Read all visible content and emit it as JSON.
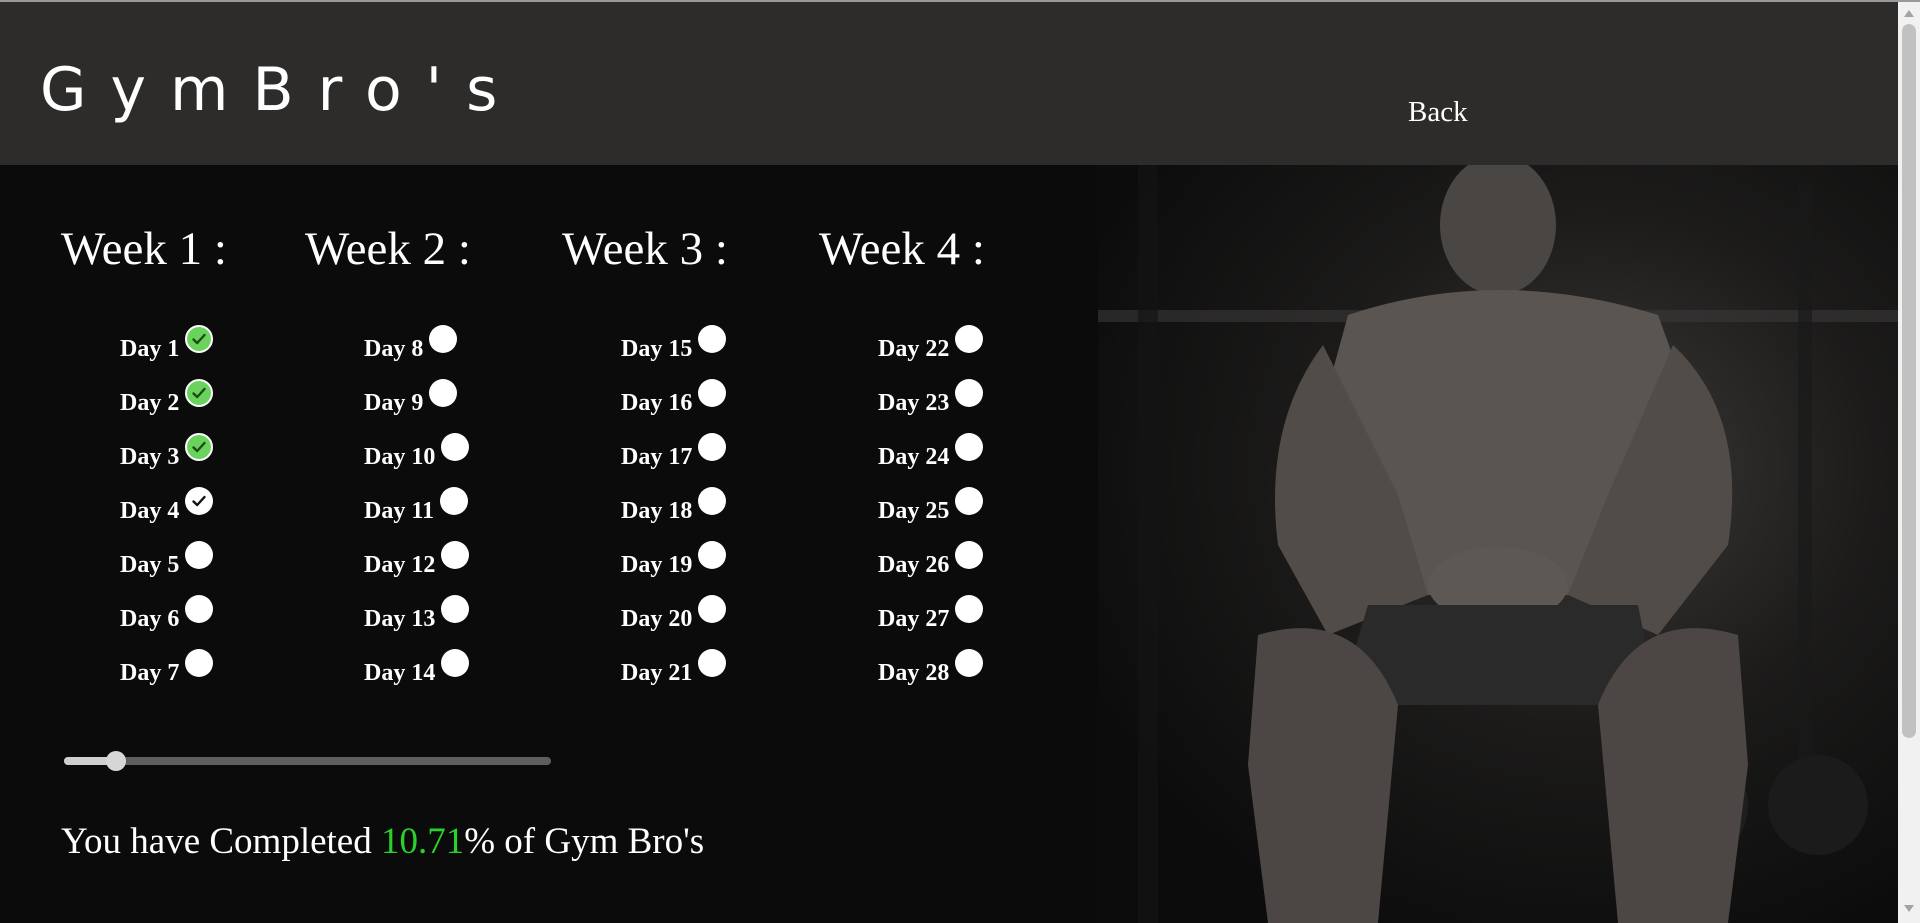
{
  "header": {
    "brand": "GymBro's",
    "back_label": "Back"
  },
  "weeks": [
    {
      "title": "Week 1 :",
      "days": [
        {
          "label": "Day 1",
          "status": "completed"
        },
        {
          "label": "Day 2",
          "status": "completed"
        },
        {
          "label": "Day 3",
          "status": "completed"
        },
        {
          "label": "Day 4",
          "status": "current"
        },
        {
          "label": "Day 5",
          "status": "pending"
        },
        {
          "label": "Day 6",
          "status": "pending"
        },
        {
          "label": "Day 7",
          "status": "pending"
        }
      ]
    },
    {
      "title": "Week 2 :",
      "days": [
        {
          "label": "Day 8",
          "status": "pending"
        },
        {
          "label": "Day 9",
          "status": "pending"
        },
        {
          "label": "Day 10",
          "status": "pending"
        },
        {
          "label": "Day 11",
          "status": "pending"
        },
        {
          "label": "Day 12",
          "status": "pending"
        },
        {
          "label": "Day 13",
          "status": "pending"
        },
        {
          "label": "Day 14",
          "status": "pending"
        }
      ]
    },
    {
      "title": "Week 3 :",
      "days": [
        {
          "label": "Day 15",
          "status": "pending"
        },
        {
          "label": "Day 16",
          "status": "pending"
        },
        {
          "label": "Day 17",
          "status": "pending"
        },
        {
          "label": "Day 18",
          "status": "pending"
        },
        {
          "label": "Day 19",
          "status": "pending"
        },
        {
          "label": "Day 20",
          "status": "pending"
        },
        {
          "label": "Day 21",
          "status": "pending"
        }
      ]
    },
    {
      "title": "Week 4 :",
      "days": [
        {
          "label": "Day 22",
          "status": "pending"
        },
        {
          "label": "Day 23",
          "status": "pending"
        },
        {
          "label": "Day 24",
          "status": "pending"
        },
        {
          "label": "Day 25",
          "status": "pending"
        },
        {
          "label": "Day 26",
          "status": "pending"
        },
        {
          "label": "Day 27",
          "status": "pending"
        },
        {
          "label": "Day 28",
          "status": "pending"
        }
      ]
    }
  ],
  "progress": {
    "fraction": 0.1071,
    "prefix": "You have Completed",
    "percent": "10.71",
    "suffix": "% of Gym Bro's"
  },
  "hero": {
    "description": "dark-gym-athlete-photo"
  },
  "colors": {
    "header_bg": "#2d2c2a",
    "page_bg": "#0b0b0b",
    "done_green": "#6ad35c",
    "percent_green": "#2ad12a"
  }
}
